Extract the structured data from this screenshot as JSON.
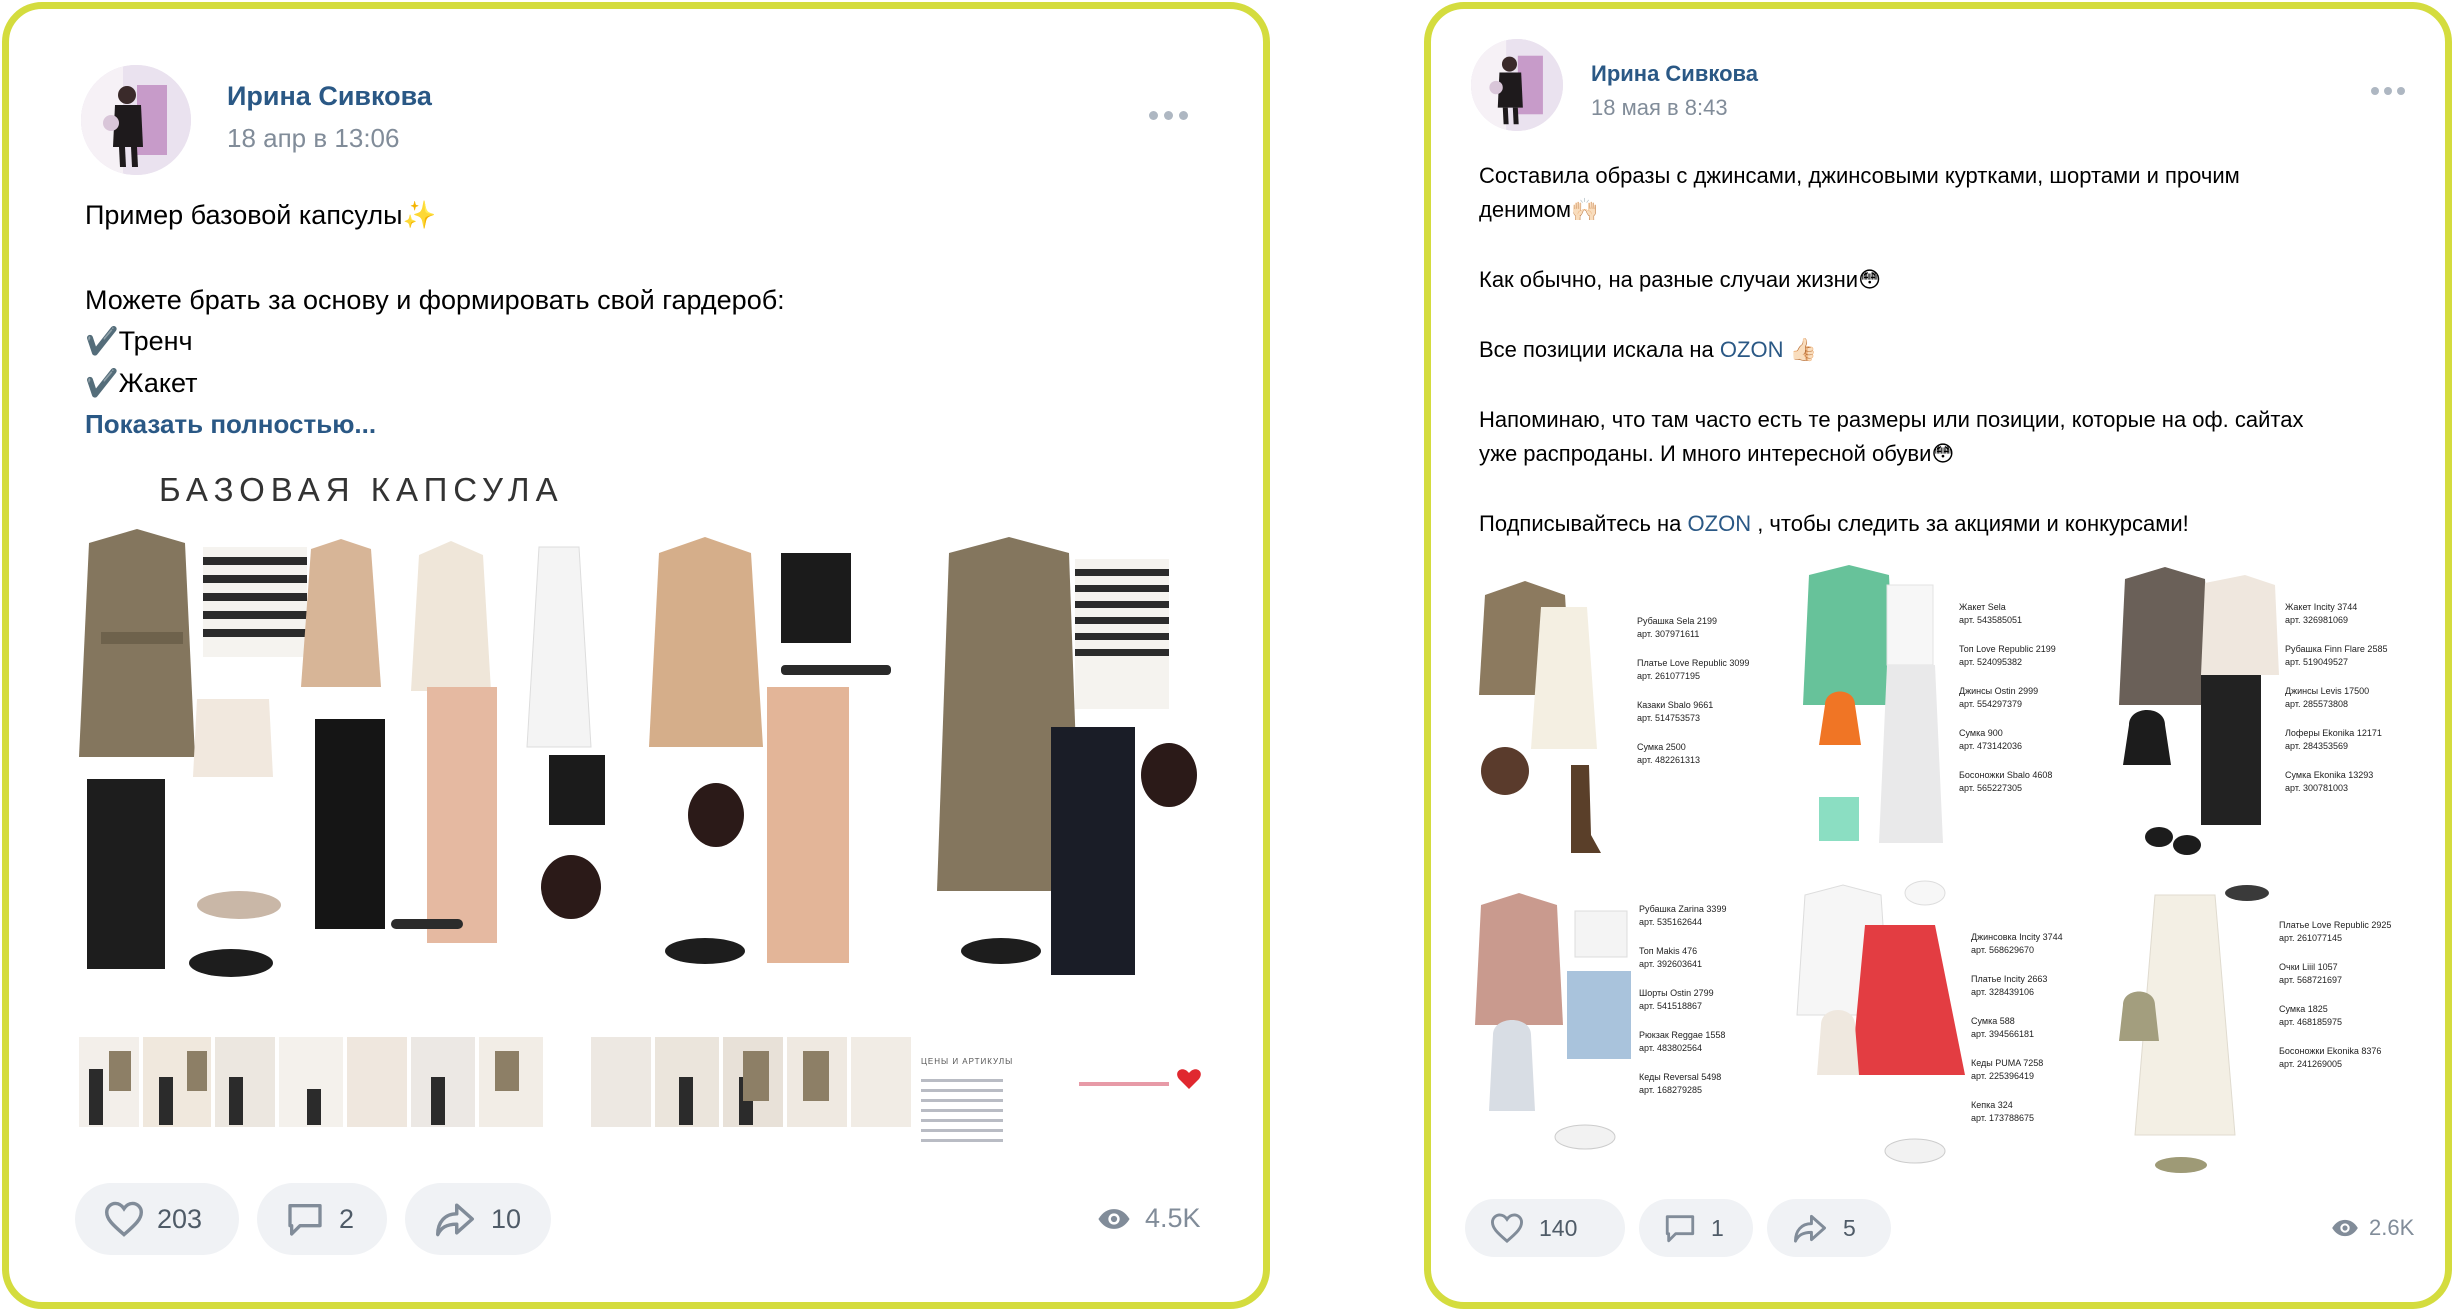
{
  "colors": {
    "frame": "#d4dc3e",
    "link": "#2a5885",
    "muted": "#818c99",
    "pill_bg": "#f0f2f5"
  },
  "post1": {
    "author": "Ирина Сивкова",
    "date": "18 апр в 13:06",
    "lines": [
      "Пример базовой капсулы✨",
      "",
      "Можете брать за основу и формировать свой гардероб:",
      "✔️Тренч",
      "✔️Жакет"
    ],
    "show_more": "Показать полностью...",
    "image_title": "БАЗОВАЯ КАПСУЛА",
    "image_small_heading": "ЦЕНЫ И АРТИКУЛЫ",
    "likes": "203",
    "comments": "2",
    "reposts": "10",
    "views": "4.5K",
    "icons": [
      "more-icon",
      "heart-icon",
      "comment-icon",
      "share-icon",
      "eye-icon"
    ]
  },
  "post2": {
    "author": "Ирина Сивкова",
    "date": "18 мая в 8:43",
    "line1": "Составила образы с джинсами, джинсовыми куртками, шортами и прочим",
    "line2": "денимом🙌🏻",
    "line3": "Как обычно, на разные случаи жизни😳",
    "line4_pre": "Все позиции искала на ",
    "line4_link": "OZON",
    "line4_post": " 👍🏻",
    "line5": "Напоминаю, что там часто есть те размеры или позиции, которые на оф. сайтах",
    "line6": "уже распроданы. И много интересной обуви😳",
    "line7_pre": "Подписывайтесь на ",
    "line7_link": "OZON",
    "line7_post": " , чтобы следить за акциями и конкурсами!",
    "outfits": [
      {
        "items": [
          "Рубашка Sela 2199",
          "арт. 307971611",
          "Платье Love Republic 3099",
          "арт. 261077195",
          "Казаки Sbalo 9661",
          "арт. 514753573",
          "Сумка 2500",
          "арт. 482261313"
        ]
      },
      {
        "items": [
          "Жакет Sela",
          "арт. 543585051",
          "Топ Love Republic 2199",
          "арт. 524095382",
          "Джинсы Ostin 2999",
          "арт. 554297379",
          "Сумка 900",
          "арт. 473142036",
          "Босоножки Sbalo 4608",
          "арт. 565227305"
        ]
      },
      {
        "items": [
          "Жакет Incity 3744",
          "арт. 326981069",
          "Рубашка Finn Flare 2585",
          "арт. 519049527",
          "Джинсы Levis 17500",
          "арт. 285573808",
          "Лоферы Ekonika 12171",
          "арт. 284353569",
          "Сумка Ekonika 13293",
          "арт. 300781003"
        ]
      },
      {
        "items": [
          "Рубашка Zarina 3399",
          "арт. 535162644",
          "Топ Makis 476",
          "арт. 392603641",
          "Шорты Ostin 2799",
          "арт. 541518867",
          "Рюкзак Reggae 1558",
          "арт. 483802564",
          "Кеды Reversal 5498",
          "арт. 168279285"
        ]
      },
      {
        "items": [
          "Джинсовка Incity 3744",
          "арт. 568629670",
          "Платье Incity 2663",
          "арт. 328439106",
          "Сумка 588",
          "арт. 394566181",
          "Кеды PUMA 7258",
          "арт. 225396419",
          "Кепка 324",
          "арт. 173788675"
        ]
      },
      {
        "items": [
          "Платье Love Republic 2925",
          "арт. 261077145",
          "Очки Liiil 1057",
          "арт. 568721697",
          "Сумка 1825",
          "арт. 468185975",
          "Босоножки Ekonika 8376",
          "арт. 241269005"
        ]
      }
    ],
    "likes": "140",
    "comments": "1",
    "reposts": "5",
    "views": "2.6K"
  }
}
